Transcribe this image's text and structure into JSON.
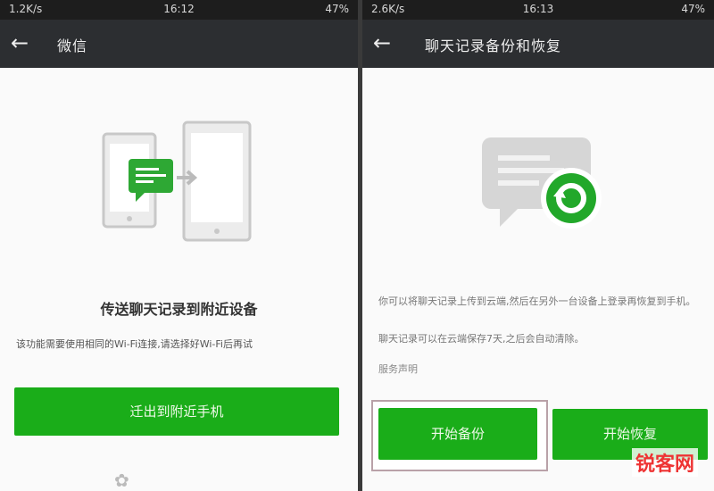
{
  "left": {
    "status": {
      "network": "1.2K/s",
      "time": "16:12",
      "battery": "47%"
    },
    "nav": {
      "back_icon": "←",
      "title": "微信"
    },
    "title": "传送聊天记录到附近设备",
    "description": "该功能需要使用相同的Wi-Fi连接,请选择好Wi-Fi后再试",
    "button": "迁出到附近手机"
  },
  "right": {
    "status": {
      "network": "2.6K/s",
      "time": "16:13",
      "battery": "47%"
    },
    "nav": {
      "back_icon": "←",
      "title": "聊天记录备份和恢复"
    },
    "text1": "你可以将聊天记录上传到云端,然后在另外一台设备上登录再恢复到手机。",
    "text2": "聊天记录可以在云端保存7天,之后会自动清除。",
    "link": "服务声明",
    "backup_button": "开始备份",
    "restore_button": "开始恢复"
  },
  "watermark": "锐客网",
  "colors": {
    "accent_green": "#1aad19",
    "nav_bg": "#2c2e31"
  }
}
